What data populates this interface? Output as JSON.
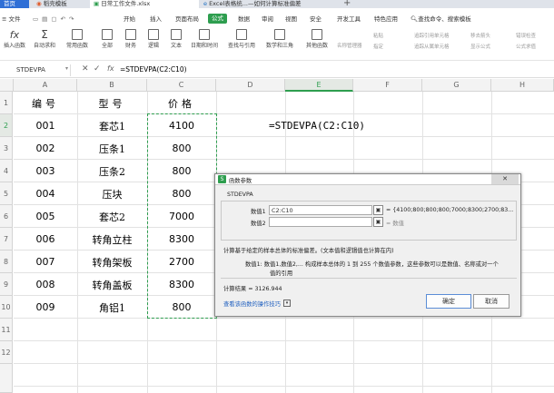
{
  "tabs": {
    "home": "首页",
    "templates": "稻壳模板",
    "workbook": "日常工作文件.xlsx",
    "browser": "Excel表格统...—如何计算标准偏差"
  },
  "menu": {
    "file": "文件",
    "items": [
      "开始",
      "插入",
      "页面布局",
      "公式",
      "数据",
      "审阅",
      "视图",
      "安全",
      "开发工具",
      "特色应用"
    ],
    "search": "查找命令、搜索模板"
  },
  "ribbon": {
    "buttons": [
      "插入函数",
      "自动求和",
      "常用函数",
      "全部",
      "财务",
      "逻辑",
      "文本",
      "日期和时间",
      "查找与引用",
      "数学和三角",
      "其他函数"
    ],
    "right": [
      "名称管理器",
      "粘贴",
      "指定",
      "追踪引用单元格",
      "追踪从属单元格",
      "移去箭头",
      "显示公式",
      "错误检查",
      "公式求值"
    ]
  },
  "formula_bar": {
    "name_box": "STDEVPA",
    "fx": "fx",
    "formula": "=STDEVPA(C2:C10)"
  },
  "columns": [
    "A",
    "B",
    "C",
    "D",
    "E",
    "F",
    "G",
    "H"
  ],
  "rows": [
    {
      "n": "1",
      "a": "编号",
      "b": "型号",
      "c": "价格"
    },
    {
      "n": "2",
      "a": "001",
      "b": "套芯1",
      "c": "4100"
    },
    {
      "n": "3",
      "a": "002",
      "b": "压条1",
      "c": "800"
    },
    {
      "n": "4",
      "a": "003",
      "b": "压条2",
      "c": "800"
    },
    {
      "n": "5",
      "a": "004",
      "b": "压块",
      "c": "800"
    },
    {
      "n": "6",
      "a": "005",
      "b": "套芯2",
      "c": "7000"
    },
    {
      "n": "7",
      "a": "006",
      "b": "转角立柱",
      "c": "8300"
    },
    {
      "n": "8",
      "a": "007",
      "b": "转角架板",
      "c": "2700"
    },
    {
      "n": "9",
      "a": "008",
      "b": "转角盖板",
      "c": "8300"
    },
    {
      "n": "10",
      "a": "009",
      "b": "角铝1",
      "c": "800"
    },
    {
      "n": "11",
      "a": "",
      "b": "",
      "c": ""
    },
    {
      "n": "12",
      "a": "",
      "b": "",
      "c": ""
    }
  ],
  "e2_formula": "=STDEVPA(C2:C10)",
  "dialog": {
    "title": "函数参数",
    "fn_name": "STDEVPA",
    "arg1_label": "数值1",
    "arg1_value": "C2:C10",
    "arg1_result": "= {4100;800;800;800;7000;8300;2700;83...",
    "arg2_label": "数值2",
    "arg2_result": "= 数值",
    "description": "计算基于给定的样本总体的标准偏差。(文本值和逻辑值也计算在内)",
    "param_desc1": "数值1: 数值1,数值2,... 构成样本总体的 1 到 255 个数值参数，这些参数可以是数值、名称或对一个",
    "param_desc2": "值的引用",
    "result": "计算结果 = 3126.944",
    "help_link": "查看该函数的操作技巧",
    "ok": "确定",
    "cancel": "取消"
  },
  "colors": {
    "accent": "#2e9e4f",
    "tab_active": "#ffffff",
    "dialog_bg": "#f0f0f0"
  }
}
